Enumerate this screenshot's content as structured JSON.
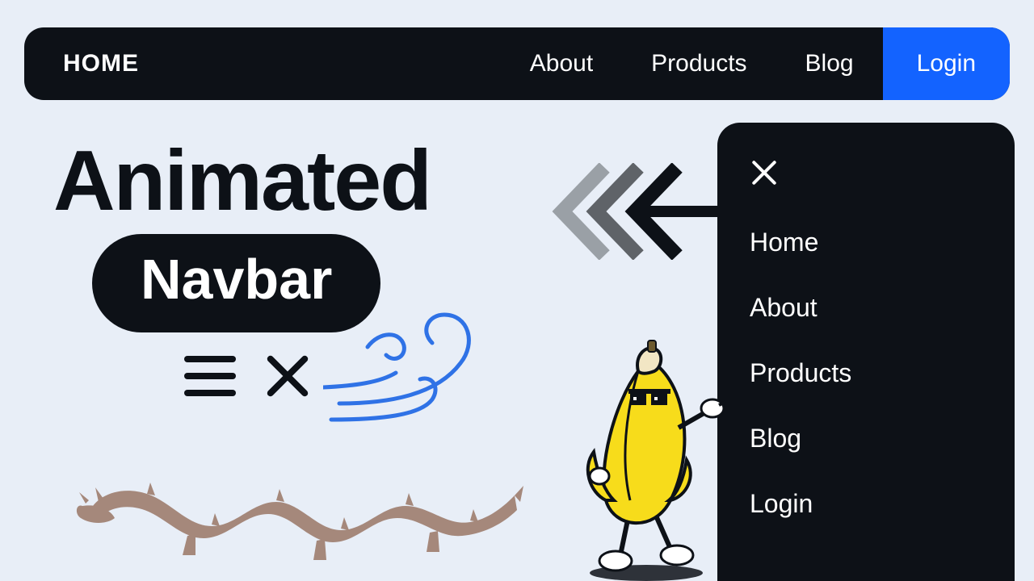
{
  "navbar": {
    "home": "HOME",
    "items": [
      {
        "label": "About"
      },
      {
        "label": "Products"
      },
      {
        "label": "Blog"
      },
      {
        "label": "Login"
      }
    ]
  },
  "headline": "Animated",
  "pill": "Navbar",
  "drawer": {
    "items": [
      {
        "label": "Home"
      },
      {
        "label": "About"
      },
      {
        "label": "Products"
      },
      {
        "label": "Blog"
      },
      {
        "label": "Login"
      }
    ]
  },
  "colors": {
    "bg": "#e8eef7",
    "dark": "#0d1117",
    "accent": "#1363ff",
    "wind": "#2f72e6",
    "dragon": "#a5887b",
    "banana": "#f7dc1b"
  }
}
